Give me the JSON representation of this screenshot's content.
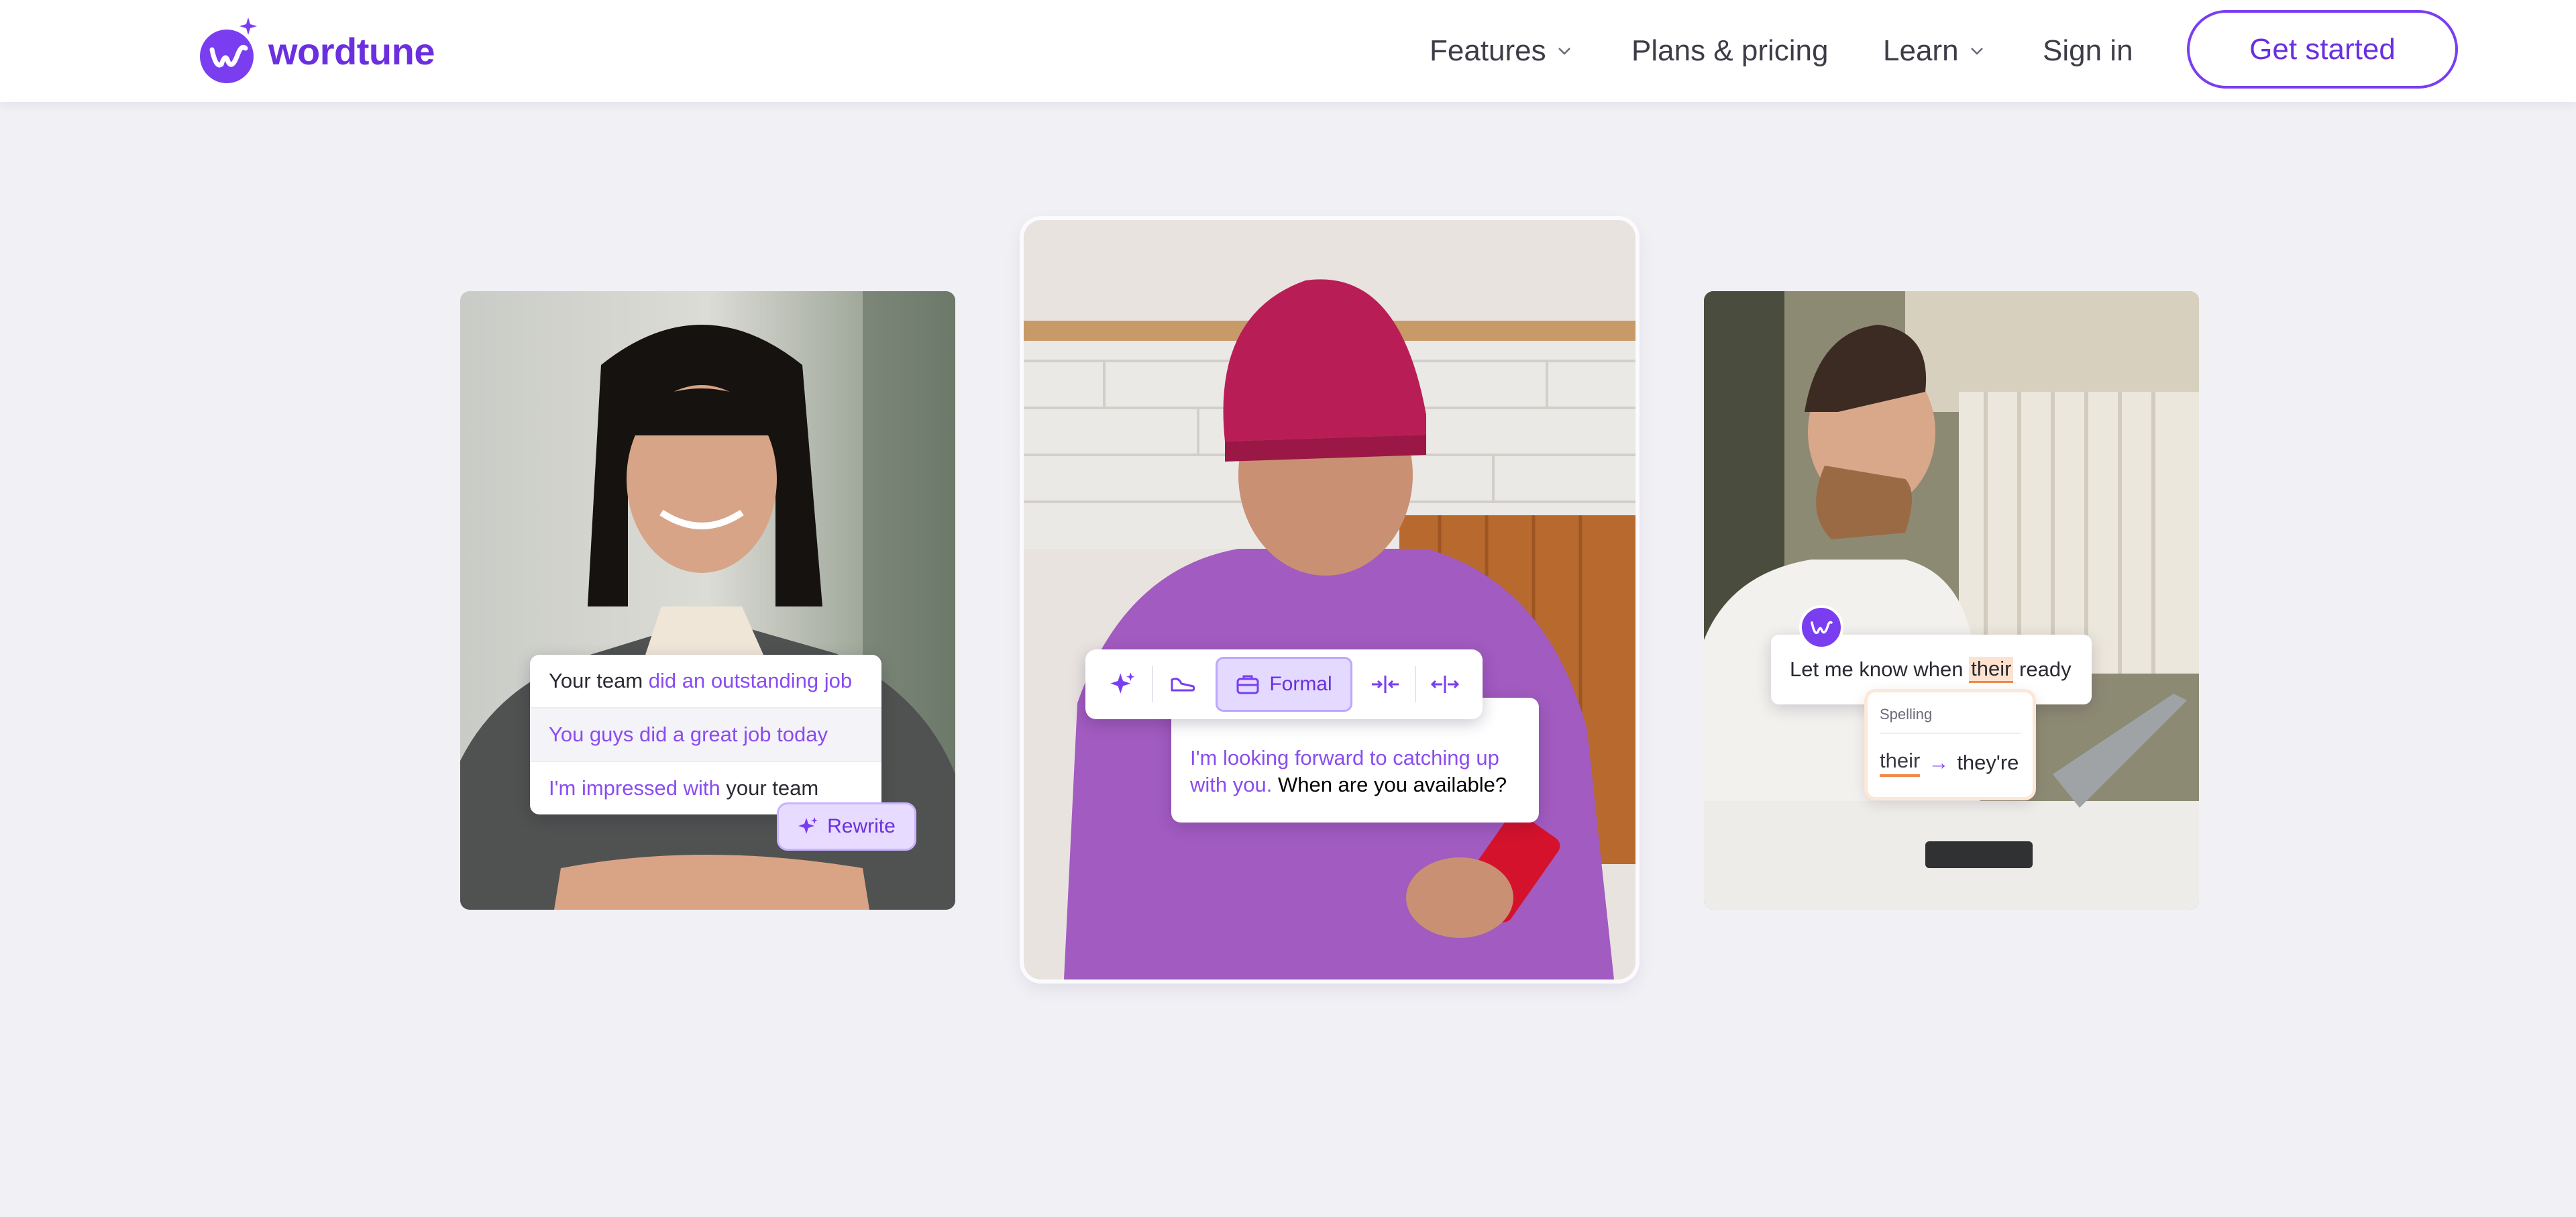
{
  "brand": {
    "name": "wordtune",
    "color": "#6b2fe0"
  },
  "nav": {
    "features": "Features",
    "plans": "Plans & pricing",
    "learn": "Learn",
    "signin": "Sign in",
    "cta": "Get started"
  },
  "card_left": {
    "rows": [
      {
        "a": "Your team ",
        "b": "did an outstanding job"
      },
      {
        "a": "",
        "b": "You guys did a great job today"
      },
      {
        "a": "I'm impressed with",
        "c": " your team"
      }
    ],
    "rewrite": "Rewrite"
  },
  "card_mid": {
    "toolbar": {
      "formal": "Formal"
    },
    "message_highlight": "I'm looking forward to catching up with you.",
    "message_rest": " When are you available?"
  },
  "card_right": {
    "sentence_start": "Let me know when ",
    "sentence_word": "their",
    "sentence_end": " ready",
    "spelling_title": "Spelling",
    "wrong": "their",
    "arrow": "→",
    "correct": "they're"
  },
  "icons": [
    "wordtune-logo-icon",
    "chevron-down-icon",
    "sparkle-icon",
    "shorten-icon",
    "briefcase-icon",
    "contract-icon",
    "expand-icon",
    "arrow-right-icon"
  ],
  "colors": {
    "accent": "#7a3ef0",
    "background": "#f1f0f5",
    "spelling_highlight": "#f08a4b"
  }
}
